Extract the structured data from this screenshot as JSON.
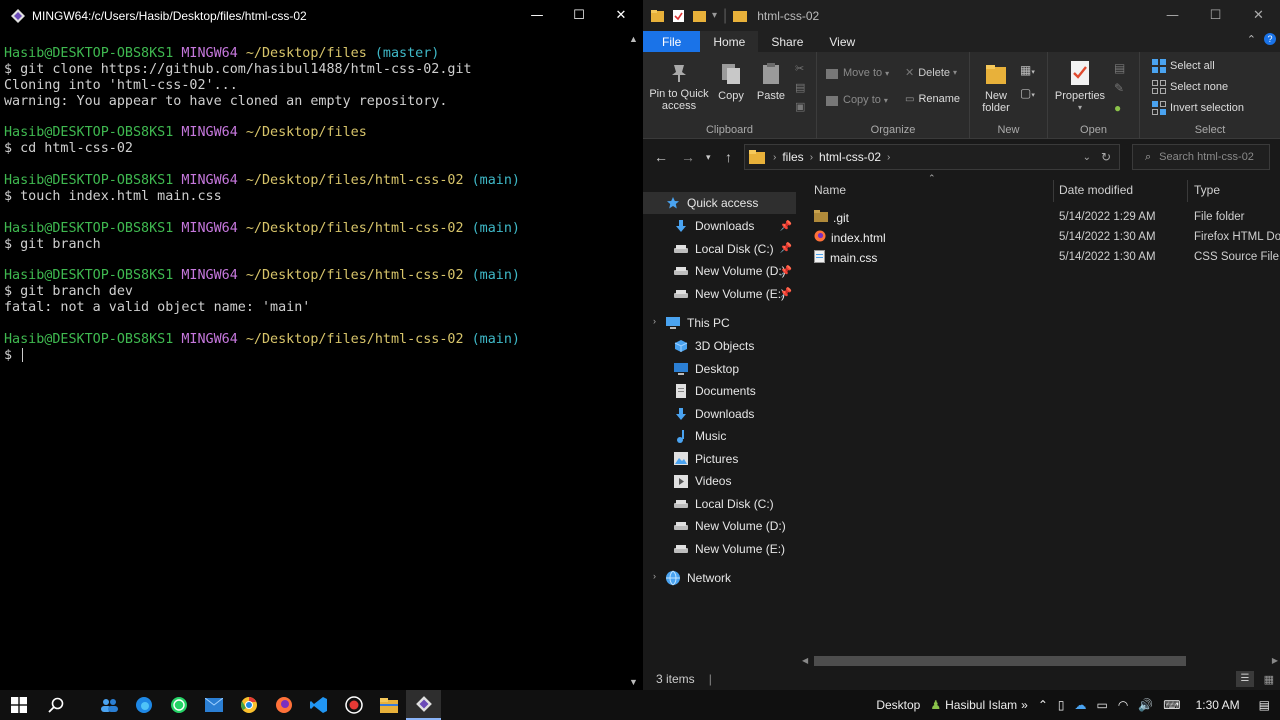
{
  "terminal": {
    "title": "MINGW64:/c/Users/Hasib/Desktop/files/html-css-02",
    "lines": [
      {
        "user": "Hasib@DESKTOP-OBS8KS1",
        "env": "MINGW64",
        "path": "~/Desktop/files",
        "branch": "(master)"
      },
      {
        "text": "$ git clone https://github.com/hasibul1488/html-css-02.git"
      },
      {
        "text": "Cloning into 'html-css-02'..."
      },
      {
        "text": "warning: You appear to have cloned an empty repository."
      },
      {
        "text": ""
      },
      {
        "user": "Hasib@DESKTOP-OBS8KS1",
        "env": "MINGW64",
        "path": "~/Desktop/files",
        "branch": ""
      },
      {
        "text": "$ cd html-css-02"
      },
      {
        "text": ""
      },
      {
        "user": "Hasib@DESKTOP-OBS8KS1",
        "env": "MINGW64",
        "path": "~/Desktop/files/html-css-02",
        "branch": "(main)"
      },
      {
        "text": "$ touch index.html main.css"
      },
      {
        "text": ""
      },
      {
        "user": "Hasib@DESKTOP-OBS8KS1",
        "env": "MINGW64",
        "path": "~/Desktop/files/html-css-02",
        "branch": "(main)"
      },
      {
        "text": "$ git branch"
      },
      {
        "text": ""
      },
      {
        "user": "Hasib@DESKTOP-OBS8KS1",
        "env": "MINGW64",
        "path": "~/Desktop/files/html-css-02",
        "branch": "(main)"
      },
      {
        "text": "$ git branch dev"
      },
      {
        "text": "fatal: not a valid object name: 'main'"
      },
      {
        "text": ""
      },
      {
        "user": "Hasib@DESKTOP-OBS8KS1",
        "env": "MINGW64",
        "path": "~/Desktop/files/html-css-02",
        "branch": "(main)"
      },
      {
        "text": "$ ",
        "cursor": true
      }
    ]
  },
  "explorer": {
    "title": "html-css-02",
    "tabs": {
      "file": "File",
      "home": "Home",
      "share": "Share",
      "view": "View"
    },
    "ribbon": {
      "clipboard": {
        "label": "Clipboard",
        "pin": "Pin to Quick access",
        "copy": "Copy",
        "paste": "Paste"
      },
      "organize": {
        "label": "Organize",
        "move_to": "Move to",
        "copy_to": "Copy to",
        "delete": "Delete",
        "rename": "Rename"
      },
      "new": {
        "label": "New",
        "new_folder": "New folder"
      },
      "open": {
        "label": "Open",
        "properties": "Properties"
      },
      "select": {
        "label": "Select",
        "select_all": "Select all",
        "select_none": "Select none",
        "invert": "Invert selection"
      }
    },
    "address": {
      "segments": [
        "files",
        "html-css-02"
      ],
      "search_placeholder": "Search html-css-02"
    },
    "nav": {
      "quick_access": "Quick access",
      "quick_items": [
        {
          "label": "Downloads",
          "icon": "download-icon"
        },
        {
          "label": "Local Disk (C:)",
          "icon": "drive-icon"
        },
        {
          "label": "New Volume (D:)",
          "icon": "drive-icon"
        },
        {
          "label": "New Volume (E:)",
          "icon": "drive-icon"
        }
      ],
      "this_pc": "This PC",
      "pc_items": [
        {
          "label": "3D Objects",
          "icon": "cube-icon"
        },
        {
          "label": "Desktop",
          "icon": "desktop-icon"
        },
        {
          "label": "Documents",
          "icon": "document-icon"
        },
        {
          "label": "Downloads",
          "icon": "download-icon"
        },
        {
          "label": "Music",
          "icon": "music-icon"
        },
        {
          "label": "Pictures",
          "icon": "picture-icon"
        },
        {
          "label": "Videos",
          "icon": "video-icon"
        },
        {
          "label": "Local Disk (C:)",
          "icon": "drive-icon"
        },
        {
          "label": "New Volume (D:)",
          "icon": "drive-icon"
        },
        {
          "label": "New Volume (E:)",
          "icon": "drive-icon"
        }
      ],
      "network": "Network"
    },
    "columns": {
      "name": "Name",
      "date": "Date modified",
      "type": "Type"
    },
    "files": [
      {
        "name": ".git",
        "date": "5/14/2022 1:29 AM",
        "type": "File folder",
        "icon": "folder-icon"
      },
      {
        "name": "index.html",
        "date": "5/14/2022 1:30 AM",
        "type": "Firefox HTML Do",
        "icon": "firefox-file-icon"
      },
      {
        "name": "main.css",
        "date": "5/14/2022 1:30 AM",
        "type": "CSS Source File",
        "icon": "file-icon"
      }
    ],
    "status": "3 items"
  },
  "taskbar": {
    "desktop": "Desktop",
    "user": "Hasibul Islam",
    "time": "1:30 AM"
  },
  "colors": {
    "accent": "#1a73e8",
    "prompt_user": "#3fb950",
    "prompt_env": "#c678dd",
    "prompt_path": "#d7c46a",
    "prompt_branch": "#3fb9c8"
  }
}
